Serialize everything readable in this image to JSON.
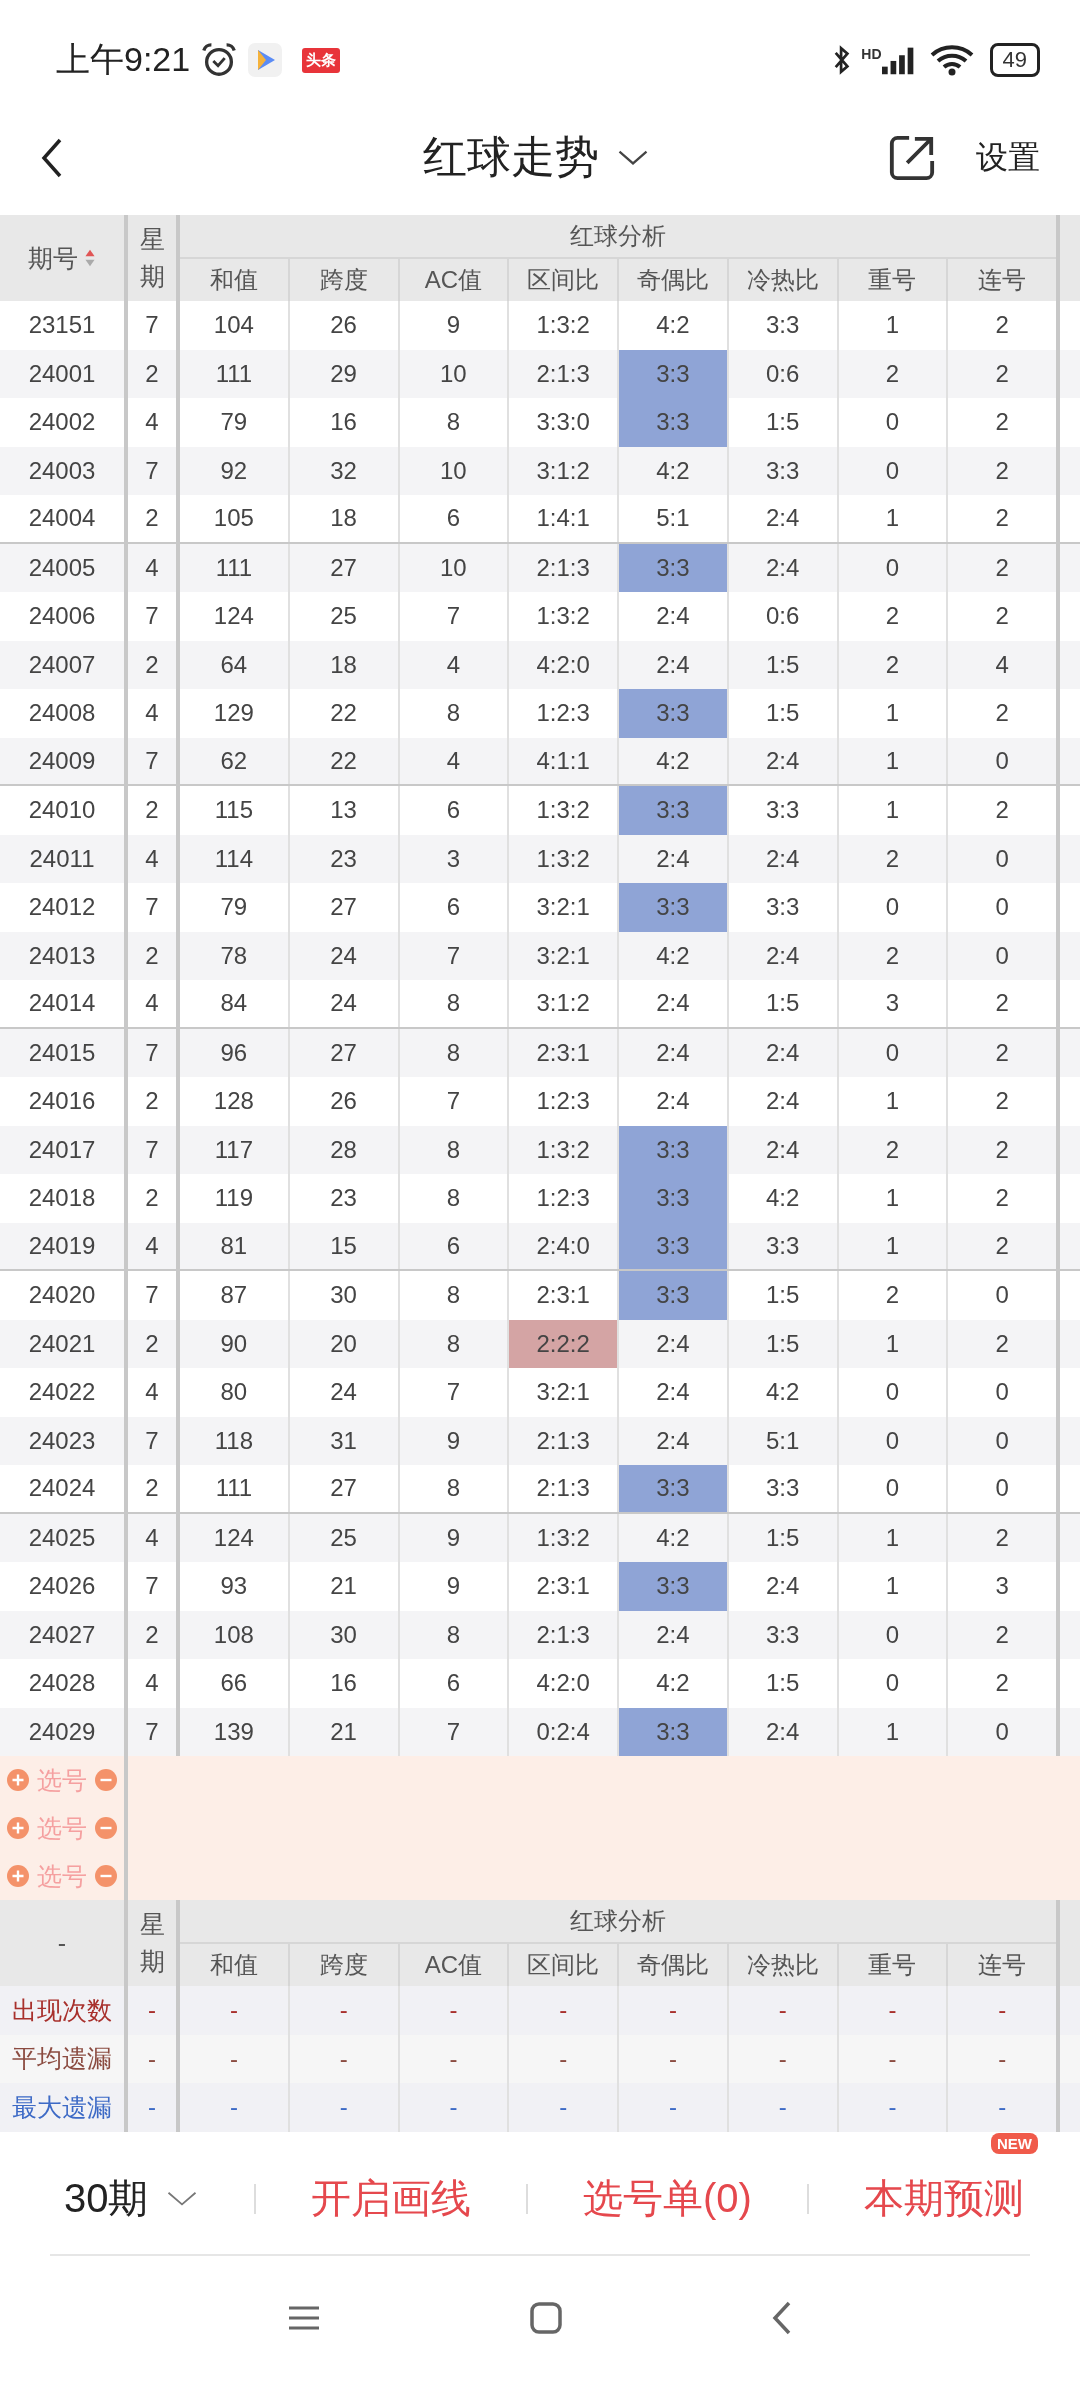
{
  "status_bar": {
    "time": "上午9:21",
    "app_badge": "头条",
    "network": "HD",
    "battery": "49"
  },
  "header": {
    "title": "红球走势",
    "action": "设置"
  },
  "table": {
    "issue_heading": "期号",
    "weekday_heading": "星期",
    "group_heading": "红球分析",
    "columns": [
      "和值",
      "跨度",
      "AC值",
      "区间比",
      "奇偶比",
      "冷热比",
      "重号",
      "连号"
    ],
    "rows": [
      {
        "issue": "23151",
        "weekday": "7",
        "cells": [
          "104",
          "26",
          "9",
          "1:3:2",
          "4:2",
          "3:3",
          "1",
          "2"
        ]
      },
      {
        "issue": "24001",
        "weekday": "2",
        "cells": [
          "111",
          "29",
          "10",
          "2:1:3",
          {
            "text": "3:3",
            "color": "#8fa4d6"
          },
          "0:6",
          "2",
          "2"
        ]
      },
      {
        "issue": "24002",
        "weekday": "4",
        "cells": [
          "79",
          "16",
          "8",
          "3:3:0",
          {
            "text": "3:3",
            "color": "#8fa4d6"
          },
          "1:5",
          "0",
          "2"
        ]
      },
      {
        "issue": "24003",
        "weekday": "7",
        "cells": [
          "92",
          "32",
          "10",
          "3:1:2",
          "4:2",
          "3:3",
          "0",
          "2"
        ]
      },
      {
        "issue": "24004",
        "weekday": "2",
        "cells": [
          "105",
          "18",
          "6",
          "1:4:1",
          "5:1",
          "2:4",
          "1",
          "2"
        ]
      },
      {
        "issue": "24005",
        "weekday": "4",
        "cells": [
          "111",
          "27",
          "10",
          "2:1:3",
          {
            "text": "3:3",
            "color": "#8fa4d6"
          },
          "2:4",
          "0",
          "2"
        ]
      },
      {
        "issue": "24006",
        "weekday": "7",
        "cells": [
          "124",
          "25",
          "7",
          "1:3:2",
          "2:4",
          "0:6",
          "2",
          "2"
        ]
      },
      {
        "issue": "24007",
        "weekday": "2",
        "cells": [
          "64",
          "18",
          "4",
          "4:2:0",
          "2:4",
          "1:5",
          "2",
          "4"
        ]
      },
      {
        "issue": "24008",
        "weekday": "4",
        "cells": [
          "129",
          "22",
          "8",
          "1:2:3",
          {
            "text": "3:3",
            "color": "#8fa4d6"
          },
          "1:5",
          "1",
          "2"
        ]
      },
      {
        "issue": "24009",
        "weekday": "7",
        "cells": [
          "62",
          "22",
          "4",
          "4:1:1",
          "4:2",
          "2:4",
          "1",
          "0"
        ]
      },
      {
        "issue": "24010",
        "weekday": "2",
        "cells": [
          "115",
          "13",
          "6",
          "1:3:2",
          {
            "text": "3:3",
            "color": "#8fa4d6"
          },
          "3:3",
          "1",
          "2"
        ]
      },
      {
        "issue": "24011",
        "weekday": "4",
        "cells": [
          "114",
          "23",
          "3",
          "1:3:2",
          "2:4",
          "2:4",
          "2",
          "0"
        ]
      },
      {
        "issue": "24012",
        "weekday": "7",
        "cells": [
          "79",
          "27",
          "6",
          "3:2:1",
          {
            "text": "3:3",
            "color": "#8fa4d6"
          },
          "3:3",
          "0",
          "0"
        ]
      },
      {
        "issue": "24013",
        "weekday": "2",
        "cells": [
          "78",
          "24",
          "7",
          "3:2:1",
          "4:2",
          "2:4",
          "2",
          "0"
        ]
      },
      {
        "issue": "24014",
        "weekday": "4",
        "cells": [
          "84",
          "24",
          "8",
          "3:1:2",
          "2:4",
          "1:5",
          "3",
          "2"
        ]
      },
      {
        "issue": "24015",
        "weekday": "7",
        "cells": [
          "96",
          "27",
          "8",
          "2:3:1",
          "2:4",
          "2:4",
          "0",
          "2"
        ]
      },
      {
        "issue": "24016",
        "weekday": "2",
        "cells": [
          "128",
          "26",
          "7",
          "1:2:3",
          "2:4",
          "2:4",
          "1",
          "2"
        ]
      },
      {
        "issue": "24017",
        "weekday": "7",
        "cells": [
          "117",
          "28",
          "8",
          "1:3:2",
          {
            "text": "3:3",
            "color": "#8fa4d6"
          },
          "2:4",
          "2",
          "2"
        ]
      },
      {
        "issue": "24018",
        "weekday": "2",
        "cells": [
          "119",
          "23",
          "8",
          "1:2:3",
          {
            "text": "3:3",
            "color": "#8fa4d6"
          },
          "4:2",
          "1",
          "2"
        ]
      },
      {
        "issue": "24019",
        "weekday": "4",
        "cells": [
          "81",
          "15",
          "6",
          "2:4:0",
          {
            "text": "3:3",
            "color": "#8fa4d6"
          },
          "3:3",
          "1",
          "2"
        ]
      },
      {
        "issue": "24020",
        "weekday": "7",
        "cells": [
          "87",
          "30",
          "8",
          "2:3:1",
          {
            "text": "3:3",
            "color": "#8fa4d6"
          },
          "1:5",
          "2",
          "0"
        ]
      },
      {
        "issue": "24021",
        "weekday": "2",
        "cells": [
          "90",
          "20",
          "8",
          {
            "text": "2:2:2",
            "color": "#d4a4a4"
          },
          "2:4",
          "1:5",
          "1",
          "2"
        ]
      },
      {
        "issue": "24022",
        "weekday": "4",
        "cells": [
          "80",
          "24",
          "7",
          "3:2:1",
          "2:4",
          "4:2",
          "0",
          "0"
        ]
      },
      {
        "issue": "24023",
        "weekday": "7",
        "cells": [
          "118",
          "31",
          "9",
          "2:1:3",
          "2:4",
          "5:1",
          "0",
          "0"
        ]
      },
      {
        "issue": "24024",
        "weekday": "2",
        "cells": [
          "111",
          "27",
          "8",
          "2:1:3",
          {
            "text": "3:3",
            "color": "#8fa4d6"
          },
          "3:3",
          "0",
          "0"
        ]
      },
      {
        "issue": "24025",
        "weekday": "4",
        "cells": [
          "124",
          "25",
          "9",
          "1:3:2",
          "4:2",
          "1:5",
          "1",
          "2"
        ]
      },
      {
        "issue": "24026",
        "weekday": "7",
        "cells": [
          "93",
          "21",
          "9",
          "2:3:1",
          {
            "text": "3:3",
            "color": "#8fa4d6"
          },
          "2:4",
          "1",
          "3"
        ]
      },
      {
        "issue": "24027",
        "weekday": "2",
        "cells": [
          "108",
          "30",
          "8",
          "2:1:3",
          "2:4",
          "3:3",
          "0",
          "2"
        ]
      },
      {
        "issue": "24028",
        "weekday": "4",
        "cells": [
          "66",
          "16",
          "6",
          "4:2:0",
          "4:2",
          "1:5",
          "0",
          "2"
        ]
      },
      {
        "issue": "24029",
        "weekday": "7",
        "cells": [
          "139",
          "21",
          "7",
          "0:2:4",
          {
            "text": "3:3",
            "color": "#8fa4d6"
          },
          "2:4",
          "1",
          "0"
        ]
      }
    ]
  },
  "pick_rows": [
    {
      "label": "选号"
    },
    {
      "label": "选号"
    },
    {
      "label": "选号"
    }
  ],
  "summary": {
    "corner": "-",
    "weekday_heading": "星期",
    "group_heading": "红球分析",
    "columns": [
      "和值",
      "跨度",
      "AC值",
      "区间比",
      "奇偶比",
      "冷热比",
      "重号",
      "连号"
    ],
    "rows": [
      {
        "label": "出现次数",
        "color": "#a8302c",
        "values": [
          "-",
          "-",
          "-",
          "-",
          "-",
          "-",
          "-",
          "-",
          "-"
        ]
      },
      {
        "label": "平均遗漏",
        "color": "#8b4b40",
        "values": [
          "-",
          "-",
          "-",
          "-",
          "-",
          "-",
          "-",
          "-",
          "-"
        ]
      },
      {
        "label": "最大遗漏",
        "color": "#3d6ac6",
        "values": [
          "-",
          "-",
          "-",
          "-",
          "-",
          "-",
          "-",
          "-",
          "-"
        ]
      }
    ]
  },
  "bottom_bar": {
    "period": "30期",
    "actions": [
      {
        "label": "开启画线"
      },
      {
        "label": "选号单(0)"
      },
      {
        "label": "本期预测",
        "badge": "NEW"
      }
    ]
  }
}
